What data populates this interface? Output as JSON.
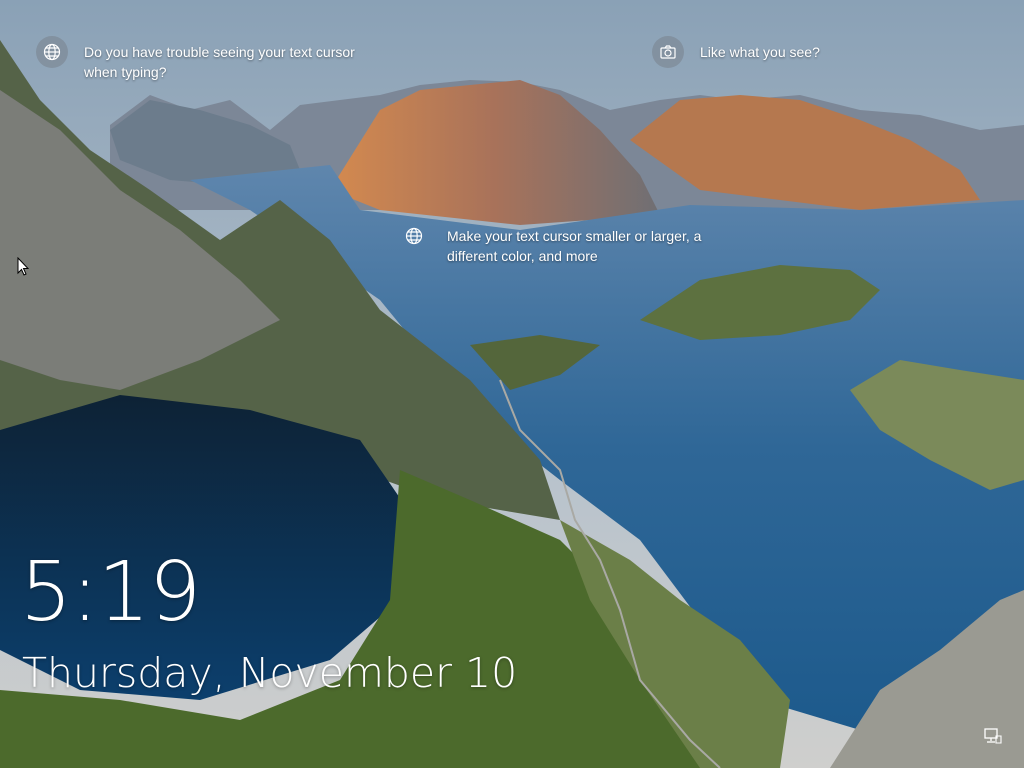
{
  "spotlight": {
    "tip_left": {
      "icon": "globe-icon",
      "text": "Do you have trouble seeing your text cursor when typing?"
    },
    "tip_right": {
      "icon": "camera-icon",
      "text": "Like what you see?"
    },
    "tip_center": {
      "icon": "globe-icon",
      "text": "Make your text cursor smaller or larger, a different color, and more"
    }
  },
  "lock": {
    "time": "5:19",
    "date": "Thursday, November 10"
  },
  "status": {
    "network_icon": "network-icon"
  }
}
